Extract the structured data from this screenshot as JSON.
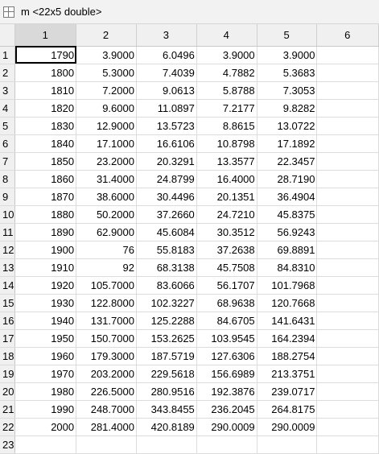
{
  "window": {
    "title": "m <22x5 double>",
    "icon": "variable-grid-icon"
  },
  "table": {
    "column_headers": [
      "1",
      "2",
      "3",
      "4",
      "5",
      "6"
    ],
    "selected_column": "1",
    "rows": [
      {
        "label": "1",
        "cells": [
          "1790",
          "3.9000",
          "6.0496",
          "3.9000",
          "3.9000",
          ""
        ]
      },
      {
        "label": "2",
        "cells": [
          "1800",
          "5.3000",
          "7.4039",
          "4.7882",
          "5.3683",
          ""
        ]
      },
      {
        "label": "3",
        "cells": [
          "1810",
          "7.2000",
          "9.0613",
          "5.8788",
          "7.3053",
          ""
        ]
      },
      {
        "label": "4",
        "cells": [
          "1820",
          "9.6000",
          "11.0897",
          "7.2177",
          "9.8282",
          ""
        ]
      },
      {
        "label": "5",
        "cells": [
          "1830",
          "12.9000",
          "13.5723",
          "8.8615",
          "13.0722",
          ""
        ]
      },
      {
        "label": "6",
        "cells": [
          "1840",
          "17.1000",
          "16.6106",
          "10.8798",
          "17.1892",
          ""
        ]
      },
      {
        "label": "7",
        "cells": [
          "1850",
          "23.2000",
          "20.3291",
          "13.3577",
          "22.3457",
          ""
        ]
      },
      {
        "label": "8",
        "cells": [
          "1860",
          "31.4000",
          "24.8799",
          "16.4000",
          "28.7190",
          ""
        ]
      },
      {
        "label": "9",
        "cells": [
          "1870",
          "38.6000",
          "30.4496",
          "20.1351",
          "36.4904",
          ""
        ]
      },
      {
        "label": "10",
        "cells": [
          "1880",
          "50.2000",
          "37.2660",
          "24.7210",
          "45.8375",
          ""
        ]
      },
      {
        "label": "11",
        "cells": [
          "1890",
          "62.9000",
          "45.6084",
          "30.3512",
          "56.9243",
          ""
        ]
      },
      {
        "label": "12",
        "cells": [
          "1900",
          "76",
          "55.8183",
          "37.2638",
          "69.8891",
          ""
        ]
      },
      {
        "label": "13",
        "cells": [
          "1910",
          "92",
          "68.3138",
          "45.7508",
          "84.8310",
          ""
        ]
      },
      {
        "label": "14",
        "cells": [
          "1920",
          "105.7000",
          "83.6066",
          "56.1707",
          "101.7968",
          ""
        ]
      },
      {
        "label": "15",
        "cells": [
          "1930",
          "122.8000",
          "102.3227",
          "68.9638",
          "120.7668",
          ""
        ]
      },
      {
        "label": "16",
        "cells": [
          "1940",
          "131.7000",
          "125.2288",
          "84.6705",
          "141.6431",
          ""
        ]
      },
      {
        "label": "17",
        "cells": [
          "1950",
          "150.7000",
          "153.2625",
          "103.9545",
          "164.2394",
          ""
        ]
      },
      {
        "label": "18",
        "cells": [
          "1960",
          "179.3000",
          "187.5719",
          "127.6306",
          "188.2754",
          ""
        ]
      },
      {
        "label": "19",
        "cells": [
          "1970",
          "203.2000",
          "229.5618",
          "156.6989",
          "213.3751",
          ""
        ]
      },
      {
        "label": "20",
        "cells": [
          "1980",
          "226.5000",
          "280.9516",
          "192.3876",
          "239.0717",
          ""
        ]
      },
      {
        "label": "21",
        "cells": [
          "1990",
          "248.7000",
          "343.8455",
          "236.2045",
          "264.8175",
          ""
        ]
      },
      {
        "label": "22",
        "cells": [
          "2000",
          "281.4000",
          "420.8189",
          "290.0009",
          "290.0009",
          ""
        ]
      },
      {
        "label": "23",
        "cells": [
          "",
          "",
          "",
          "",
          "",
          ""
        ]
      }
    ]
  }
}
